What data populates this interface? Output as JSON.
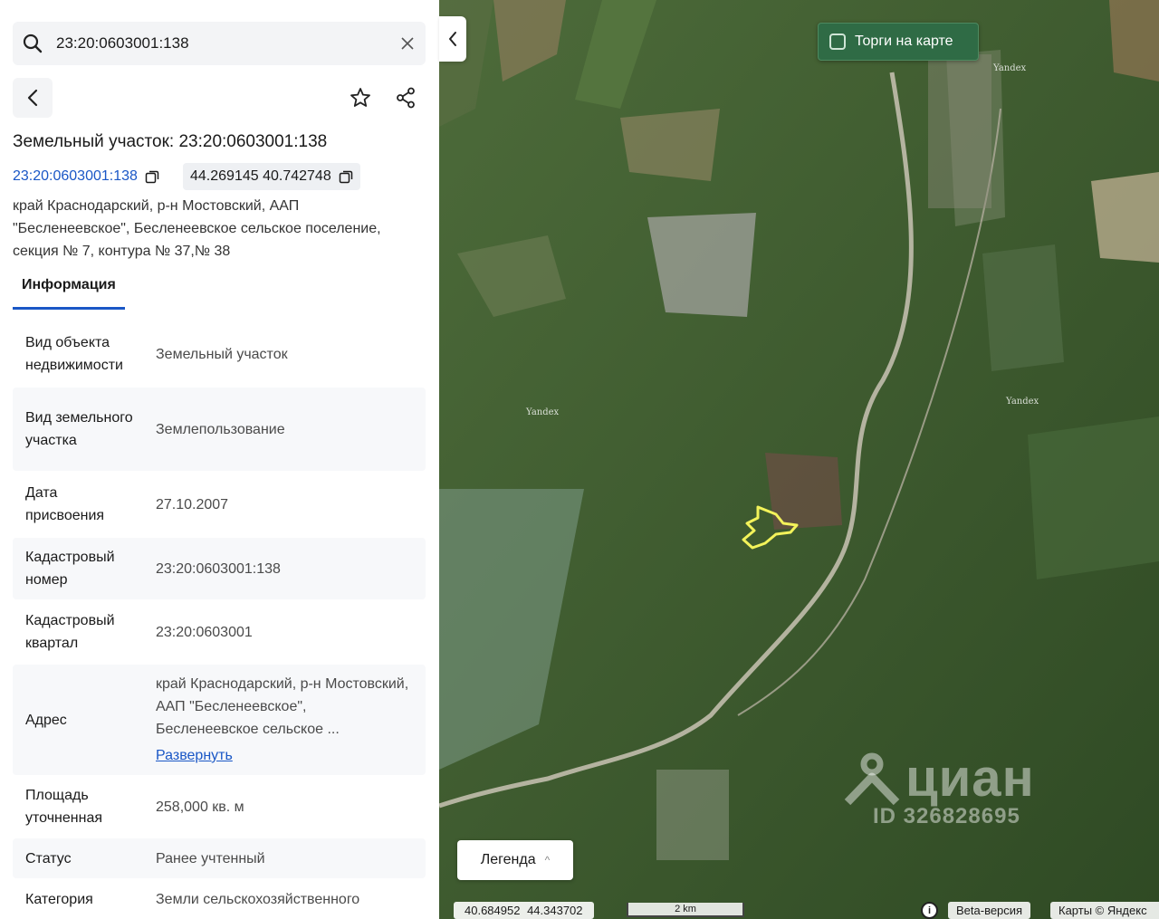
{
  "search": {
    "value": "23:20:0603001:138",
    "placeholder": ""
  },
  "header": {
    "title": "Земельный участок: 23:20:0603001:138"
  },
  "parcel": {
    "cadastral_link": "23:20:0603001:138",
    "coordinates": "44.269145 40.742748",
    "address": "край Краснодарский, р-н Мостовский, ААП \"Бесленеевское\", Бесленеевское сельское поселение, секция № 7, контура № 37,№ 38"
  },
  "tabs": [
    {
      "label": "Информация",
      "active": true
    }
  ],
  "info": [
    {
      "key": "Вид объекта недвижимости",
      "value": "Земельный участок"
    },
    {
      "key": "Вид земельного участка",
      "value": "Землепользование"
    },
    {
      "key": "Дата присвоения",
      "value": "27.10.2007"
    },
    {
      "key": "Кадастровый номер",
      "value": "23:20:0603001:138"
    },
    {
      "key": "Кадастровый квартал",
      "value": "23:20:0603001"
    },
    {
      "key": "Адрес",
      "value": "край Краснодарский, р-н Мостовский, ААП \"Бесленеевское\", Бесленеевское сельское ...",
      "more": "Развернуть"
    },
    {
      "key": "Площадь уточненная",
      "value": "258,000 кв. м"
    },
    {
      "key": "Статус",
      "value": "Ранее учтенный"
    },
    {
      "key": "Категория",
      "value": "Земли сельскохозяйственного"
    }
  ],
  "map": {
    "torgi_label": "Торги на карте",
    "torgi_checked": false,
    "legend_label": "Легенда",
    "cursor_coords": "40.684952 44.343702",
    "scale_label": "2 km",
    "beta_label": "Beta-версия",
    "copyright": "Карты © Яндекс",
    "tile_labels": [
      "Yandex",
      "Yandex",
      "Yandex"
    ],
    "watermark_brand": "циан",
    "watermark_id": "ID 326828695",
    "parcel_color": "#f3f35a"
  },
  "colors": {
    "accent": "#1a57c6",
    "torgi_bg": "#2f6b45"
  }
}
